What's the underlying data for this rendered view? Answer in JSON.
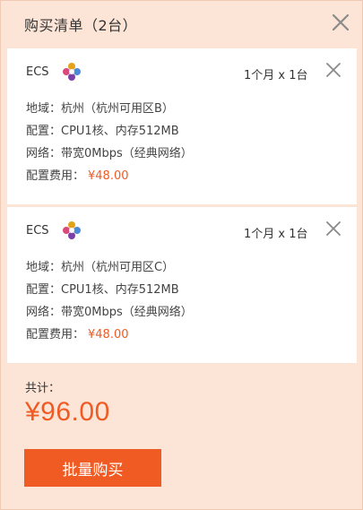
{
  "cart": {
    "title": "购买清单（2台）",
    "items": [
      {
        "name": "ECS",
        "qty": "1个月 x 1台",
        "region": "地域：杭州（杭州可用区B）",
        "config": "配置：CPU1核、内存512MB",
        "network": "网络：带宽0Mbps（经典网络）",
        "fee_label": "配置费用：",
        "fee_value": "¥48.00"
      },
      {
        "name": "ECS",
        "qty": "1个月 x 1台",
        "region": "地域：杭州（杭州可用区C）",
        "config": "配置：CPU1核、内存512MB",
        "network": "网络：带宽0Mbps（经典网络）",
        "fee_label": "配置费用：",
        "fee_value": "¥48.00"
      }
    ],
    "total_label": "共计：",
    "total_value": "¥96.00",
    "buy_label": "批量购买"
  },
  "icons": {
    "close": "close-icon",
    "product_logo": "ecs-logo-icon"
  },
  "colors": {
    "accent": "#f05a23",
    "panel_bg": "#fce5d6",
    "card_bg": "#ffffff"
  }
}
